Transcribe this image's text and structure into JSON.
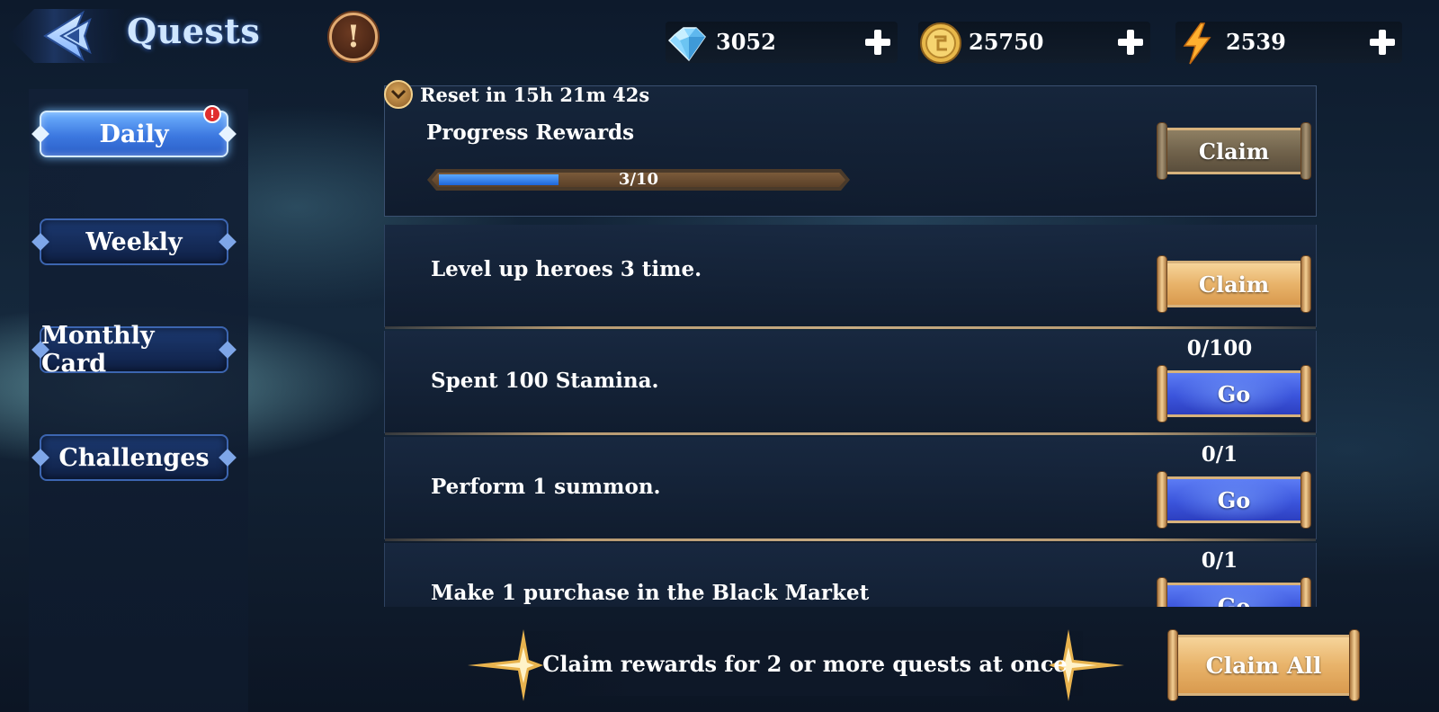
{
  "header": {
    "title": "Quests",
    "info_label": "!",
    "resources": [
      {
        "icon": "diamond-icon",
        "value": "3052"
      },
      {
        "icon": "gold-coin-icon",
        "value": "25750"
      },
      {
        "icon": "lightning-icon",
        "value": "2539"
      }
    ]
  },
  "sidebar": {
    "tabs": [
      {
        "label": "Daily",
        "active": true,
        "badge": "!"
      },
      {
        "label": "Weekly"
      },
      {
        "label": "Monthly Card"
      },
      {
        "label": "Challenges"
      }
    ]
  },
  "reset": {
    "text": "Reset in 15h 21m 42s"
  },
  "progress": {
    "title": "Progress Rewards",
    "current": 3,
    "total": 10,
    "text": "3/10",
    "claim_label": "Claim"
  },
  "quests": [
    {
      "title": "Level up heroes 3 time.",
      "count": "",
      "button": "Claim"
    },
    {
      "title": "Spent 100 Stamina.",
      "count": "0/100",
      "button": "Go"
    },
    {
      "title": "Perform 1 summon.",
      "count": "0/1",
      "button": "Go"
    },
    {
      "title": "Make 1 purchase in the Black Market",
      "count": "0/1",
      "button": "Go"
    }
  ],
  "footer": {
    "text": "Claim rewards for 2 or more quests at once",
    "claim_all_label": "Claim All"
  },
  "colors": {
    "accent_blue": "#3c78e0",
    "gold": "#e8b36a",
    "background": "#15283c"
  }
}
